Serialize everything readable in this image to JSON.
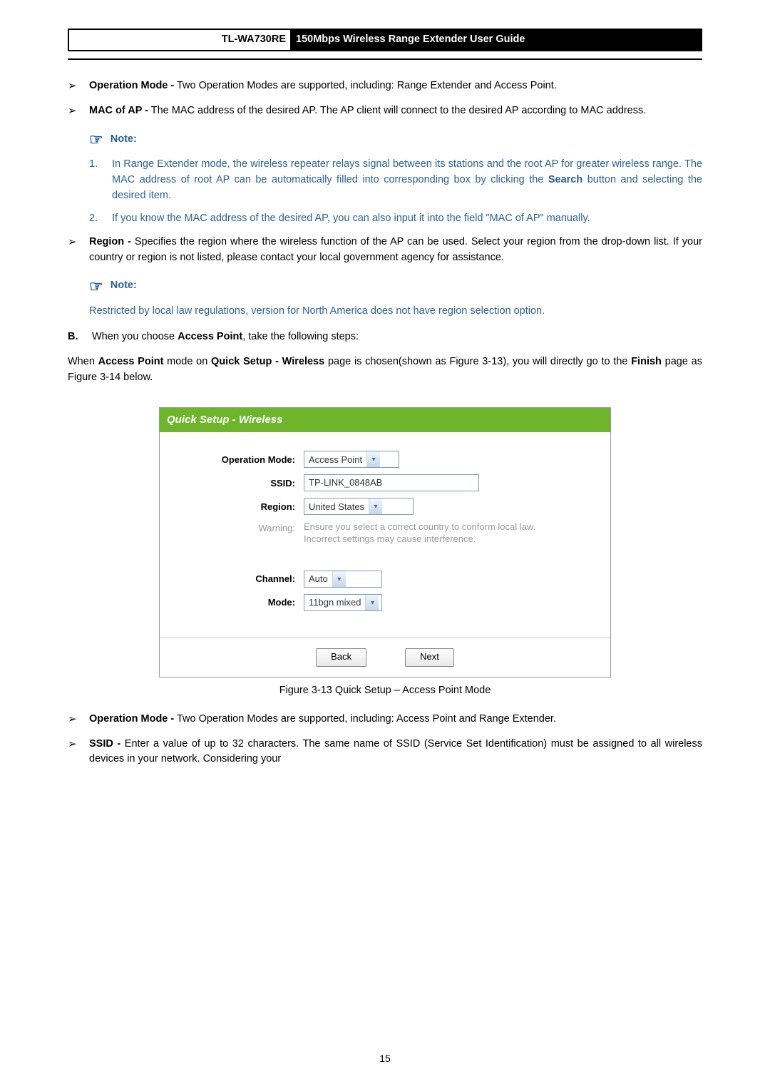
{
  "header": {
    "model": "TL-WA730RE",
    "title": "150Mbps Wireless Range Extender User Guide"
  },
  "bullets_top": [
    {
      "term": "Operation Mode -",
      "desc": " Two Operation Modes are supported, including: Range Extender and Access Point."
    },
    {
      "term": "MAC of AP -",
      "desc": " The MAC address of the desired AP. The AP client will connect to the desired AP according to MAC address."
    }
  ],
  "note_label": "Note:",
  "notes1": [
    "In Range Extender mode, the wireless repeater relays signal between its stations and the root AP for greater wireless range. The MAC address of root AP can be automatically filled into corresponding box by clicking the Search button and selecting the desired item.",
    "If you know the MAC address of the desired AP, you can also input it into the field \"MAC of AP\" manually."
  ],
  "notes1_bold_word": "Search",
  "region_bullet": {
    "term": "Region -",
    "desc": " Specifies the region where the wireless function of the AP can be used. Select your region from the drop-down list. If your country or region is not listed, please contact your local government agency for assistance."
  },
  "note2_text": "Restricted by local law regulations, version for North America does not have region selection option.",
  "section_b": {
    "label": "B.",
    "prefix": "When you choose ",
    "bold": "Access Point",
    "suffix": ", take the following steps:"
  },
  "para_ap": {
    "p1": "When ",
    "b1": "Access Point",
    "p2": " mode on ",
    "b2": "Quick Setup - Wireless",
    "p3": " page is chosen(shown as Figure 3-13), you will directly go to the ",
    "b3": "Finish",
    "p4": " page as Figure 3-14 below."
  },
  "figure": {
    "title": "Quick Setup - Wireless",
    "labels": {
      "op_mode": "Operation Mode:",
      "ssid": "SSID:",
      "region": "Region:",
      "warning": "Warning:",
      "channel": "Channel:",
      "mode": "Mode:"
    },
    "values": {
      "op_mode": "Access Point",
      "ssid": "TP-LINK_0848AB",
      "region": "United States",
      "warning_l1": "Ensure you select a correct country to conform local law.",
      "warning_l2": "Incorrect settings may cause interference.",
      "channel": "Auto",
      "mode": "11bgn mixed"
    },
    "buttons": {
      "back": "Back",
      "next": "Next"
    },
    "caption": "Figure 3-13 Quick Setup – Access Point Mode"
  },
  "bullets_bottom": [
    {
      "term": "Operation Mode -",
      "desc": " Two Operation Modes are supported, including: Access Point and Range Extender."
    },
    {
      "term": "SSID -",
      "desc": " Enter a value of up to 32 characters. The same name of SSID (Service Set Identification) must be assigned to all wireless devices in your network. Considering your"
    }
  ],
  "page_number": "15"
}
